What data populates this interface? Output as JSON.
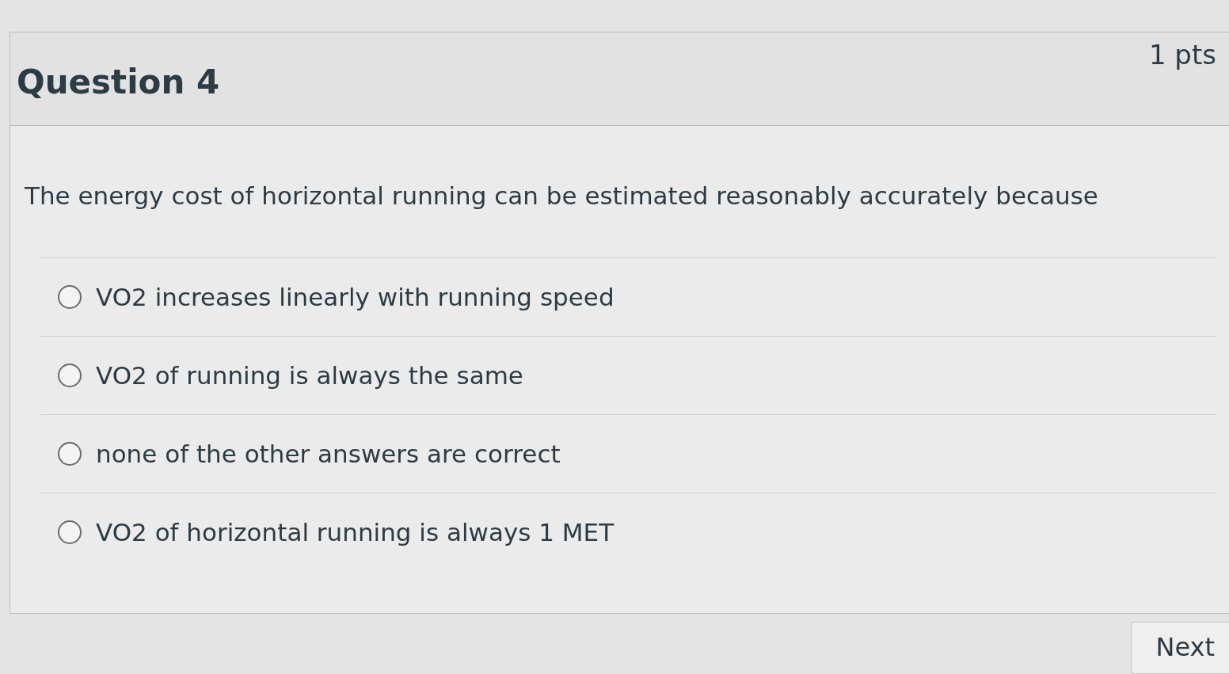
{
  "question": {
    "title": "Question 4",
    "points": "1 pts",
    "text": "The energy cost of horizontal running can be estimated reasonably accurately because"
  },
  "answers": [
    {
      "label": "VO2 increases linearly with running speed",
      "selected": false
    },
    {
      "label": "VO2 of running is always the same",
      "selected": false
    },
    {
      "label": "none of the other answers are correct",
      "selected": false
    },
    {
      "label": "VO2 of horizontal running is always 1 MET",
      "selected": false
    }
  ],
  "buttons": [
    {
      "label": "Next"
    }
  ]
}
